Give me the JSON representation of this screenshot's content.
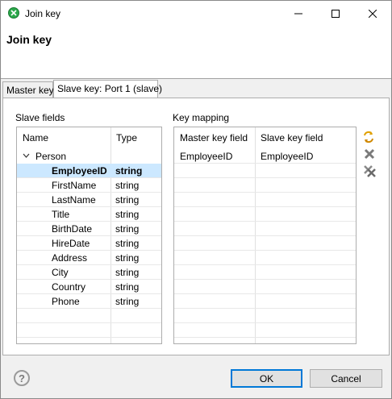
{
  "window": {
    "title": "Join key"
  },
  "header": {
    "title": "Join key"
  },
  "tabs": [
    {
      "label": "Master key"
    },
    {
      "label": "Slave key: Port 1 (slave)"
    }
  ],
  "slave_fields": {
    "label": "Slave fields",
    "columns": {
      "name": "Name",
      "type": "Type"
    },
    "group": "Person",
    "rows": [
      {
        "name": "EmployeeID",
        "type": "string"
      },
      {
        "name": "FirstName",
        "type": "string"
      },
      {
        "name": "LastName",
        "type": "string"
      },
      {
        "name": "Title",
        "type": "string"
      },
      {
        "name": "BirthDate",
        "type": "string"
      },
      {
        "name": "HireDate",
        "type": "string"
      },
      {
        "name": "Address",
        "type": "string"
      },
      {
        "name": "City",
        "type": "string"
      },
      {
        "name": "Country",
        "type": "string"
      },
      {
        "name": "Phone",
        "type": "string"
      }
    ]
  },
  "key_mapping": {
    "label": "Key mapping",
    "columns": {
      "master": "Master key field",
      "slave": "Slave key field"
    },
    "rows": [
      {
        "master": "EmployeeID",
        "slave": "EmployeeID"
      }
    ]
  },
  "icons": {
    "app": "join-key-app-icon",
    "auto_mapping": "auto-mapping-icon",
    "delete": "delete-icon",
    "delete_all": "delete-all-icon"
  },
  "colors": {
    "selection": "#cce8ff",
    "accent": "#0078d7"
  },
  "footer": {
    "help": "?",
    "ok": "OK",
    "cancel": "Cancel"
  }
}
